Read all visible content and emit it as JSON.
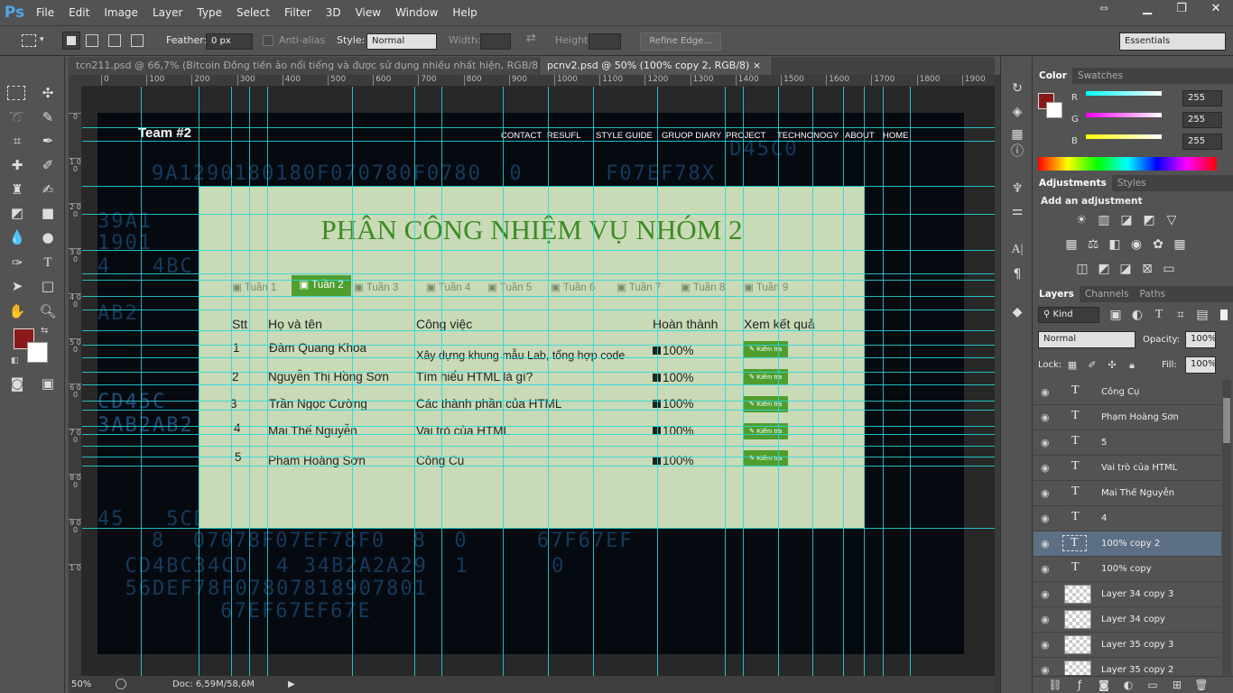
{
  "app": {
    "logo": "Ps"
  },
  "menu": [
    "File",
    "Edit",
    "Image",
    "Layer",
    "Type",
    "Select",
    "Filter",
    "3D",
    "View",
    "Window",
    "Help"
  ],
  "options": {
    "feather_label": "Feather:",
    "feather_value": "0 px",
    "antialias_label": "Anti-alias",
    "style_label": "Style:",
    "style_value": "Normal",
    "width_label": "Width:",
    "height_label": "Height:",
    "refine_edge": "Refine Edge...",
    "workspace": "Essentials"
  },
  "tabs": [
    {
      "label": "tcn211.psd @ 66,7% (Bitcoin  Đồng tiền ảo nổi tiếng và được sử dụng nhiều nhất hiện, RGB/8)",
      "close": "×"
    },
    {
      "label": "pcnv2.psd @ 50% (100% copy 2, RGB/8)",
      "close": "×"
    }
  ],
  "ruler_top": [
    "0",
    "100",
    "200",
    "300",
    "400",
    "500",
    "600",
    "700",
    "800",
    "900",
    "1000",
    "1100",
    "1200",
    "1300",
    "1400",
    "1500",
    "1600",
    "1700",
    "1800",
    "1900"
  ],
  "ruler_left": [
    "0",
    "1 0 0",
    "2 0 0",
    "3 0 0",
    "4 0 0",
    "5 0 0",
    "6 0 0",
    "7 0 0",
    "8 0 0",
    "9 0 0",
    "1 0"
  ],
  "site": {
    "logo": "Team #2",
    "nav": [
      "CONTACT",
      "RESUFL",
      "STYLE GUIDE",
      "GRUOP DIARY",
      "PROJECT",
      "TECHNONOGY",
      "ABOUT",
      "HOME"
    ],
    "heading": "PHÂN CÔNG NHIỆM VỤ NHÓM 2",
    "weeks": [
      "Tuần 1",
      "Tuần 2",
      "Tuần 3",
      "Tuần 4",
      "Tuần 5",
      "Tuần 6",
      "Tuần 7",
      "Tuần 8",
      "Tuần 9"
    ],
    "headers": [
      "Stt",
      "Họ và tên",
      "Công việc",
      "Hoàn thành",
      "Xem kết quả"
    ],
    "rows": [
      {
        "stt": "1",
        "name": "Đàm Quang Khoa",
        "task": "Xây dựng khung mẫu Lab, tổng hợp code",
        "done": "100%",
        "btn": "Kiểm tra"
      },
      {
        "stt": "2",
        "name": "Nguyễn Thị Hồng Sơn",
        "task": "Tìm hiểu HTML là gì?",
        "done": "100%",
        "btn": "Kiểm tra"
      },
      {
        "stt": "3",
        "name": "Trần Ngọc Cường",
        "task": "Các thành phần của HTML",
        "done": "100%",
        "btn": "Kiểm tra"
      },
      {
        "stt": "4",
        "name": "Mai Thế Nguyễn",
        "task": "Vai trò của HTML",
        "done": "100%",
        "btn": "Kiểm tra"
      },
      {
        "stt": "5",
        "name": "Phạm Hoàng Sơn",
        "task": "Công Cụ",
        "done": "100%",
        "btn": "Kiểm tra"
      }
    ]
  },
  "status": {
    "zoom": "50%",
    "doc": "Doc: 6,59M/58,6M"
  },
  "color_panel": {
    "tabs": [
      "Color",
      "Swatches"
    ],
    "r_label": "R",
    "g_label": "G",
    "b_label": "B",
    "r": "255",
    "g": "255",
    "b": "255",
    "fg": "#8a1a1a"
  },
  "adjustments": {
    "tabs": [
      "Adjustments",
      "Styles"
    ],
    "title": "Add an adjustment"
  },
  "layers_panel": {
    "tabs": [
      "Layers",
      "Channels",
      "Paths"
    ],
    "kind": "Kind",
    "blend": "Normal",
    "opacity_label": "Opacity:",
    "opacity": "100%",
    "lock_label": "Lock:",
    "fill_label": "Fill:",
    "fill": "100%",
    "layers": [
      {
        "name": "Công Cụ",
        "type": "text"
      },
      {
        "name": "Phạm Hoàng Sơn",
        "type": "text"
      },
      {
        "name": "5",
        "type": "text"
      },
      {
        "name": "Vai trò của HTML",
        "type": "text"
      },
      {
        "name": "Mai Thế Nguyễn",
        "type": "text"
      },
      {
        "name": "4",
        "type": "text"
      },
      {
        "name": "100% copy 2",
        "type": "text",
        "selected": true
      },
      {
        "name": "100% copy",
        "type": "text"
      },
      {
        "name": "Layer 34 copy 3",
        "type": "raster"
      },
      {
        "name": "Layer 34 copy",
        "type": "raster"
      },
      {
        "name": "Layer 35 copy 3",
        "type": "raster"
      },
      {
        "name": "Layer 35 copy 2",
        "type": "raster"
      }
    ]
  }
}
